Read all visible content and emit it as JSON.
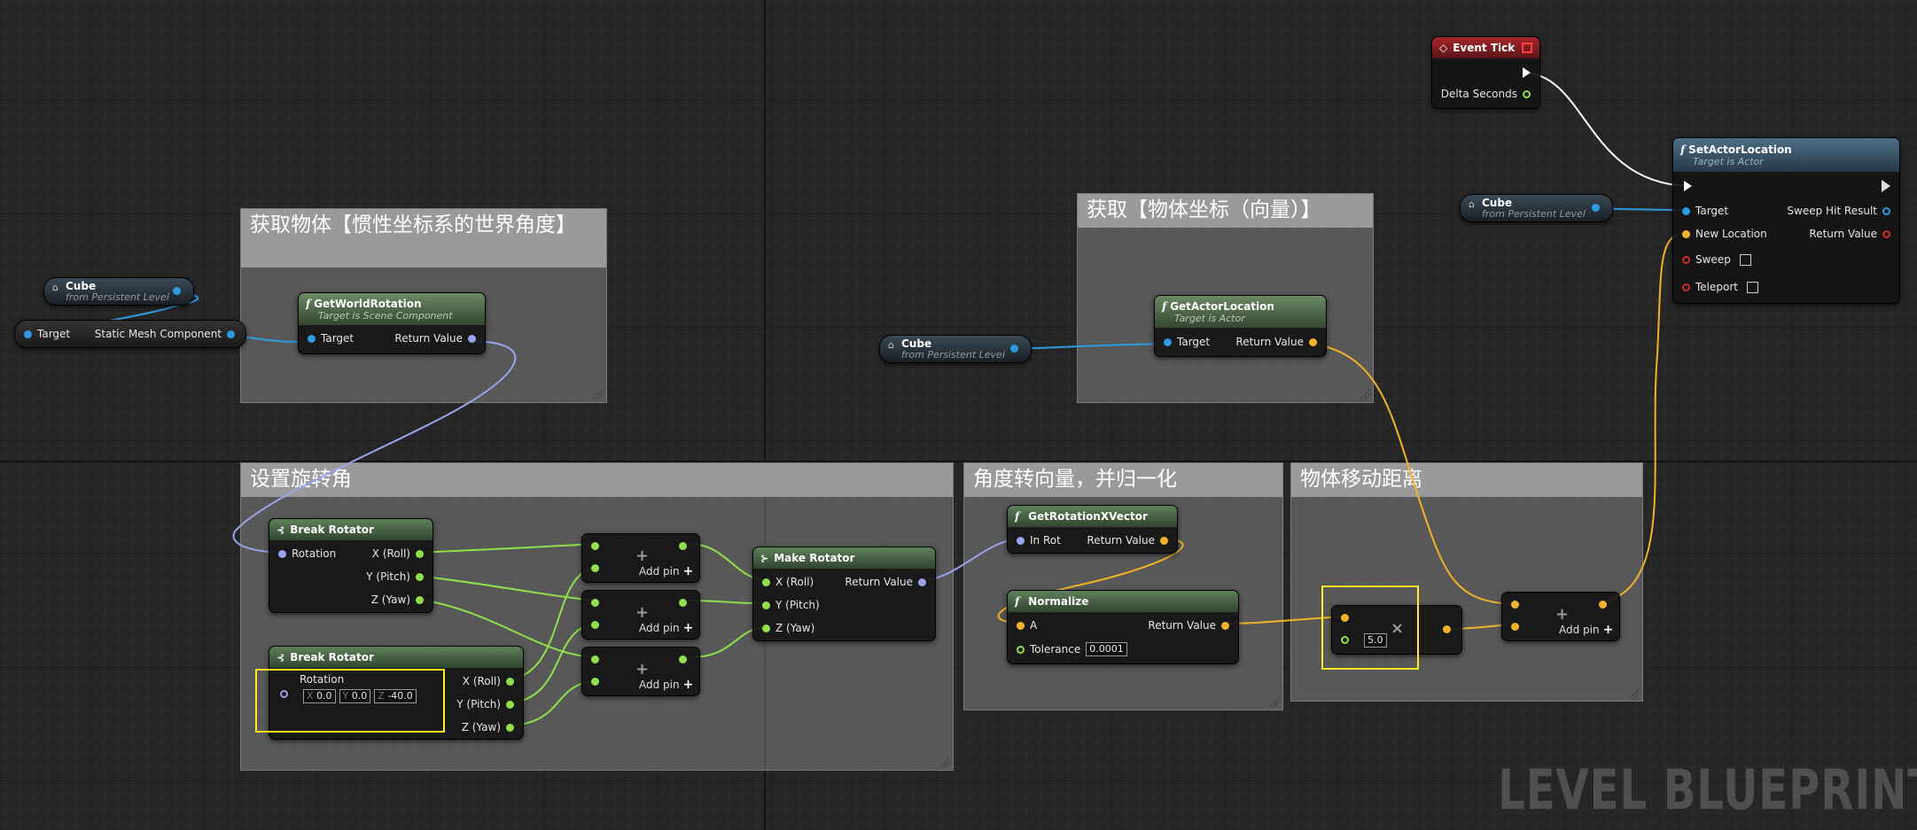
{
  "comments": {
    "get_rotation": "获取物体【惯性坐标系的世界角度】",
    "set_rotation": "设置旋转角",
    "get_location": "获取【物体坐标（向量）】",
    "angle_to_vector": "角度转向量，并归一化",
    "move_distance": "物体移动距离"
  },
  "cube_ref": {
    "name": "Cube",
    "sub": "from Persistent Level"
  },
  "target_node": {
    "target": "Target",
    "out": "Static Mesh Component"
  },
  "get_world_rotation": {
    "title": "GetWorldRotation",
    "sub": "Target is Scene Component",
    "in": "Target",
    "out": "Return Value"
  },
  "get_actor_location": {
    "title": "GetActorLocation",
    "sub": "Target is Actor",
    "in": "Target",
    "out": "Return Value"
  },
  "event_tick": {
    "title": "Event Tick",
    "out": "Delta Seconds"
  },
  "set_actor_location": {
    "title": "SetActorLocation",
    "sub": "Target is Actor",
    "target": "Target",
    "new_location": "New Location",
    "sweep": "Sweep",
    "teleport": "Teleport",
    "sweep_hit": "Sweep Hit Result",
    "ret": "Return Value"
  },
  "break_rotator_1": {
    "title": "Break Rotator",
    "in": "Rotation",
    "x": "X (Roll)",
    "y": "Y (Pitch)",
    "z": "Z (Yaw)"
  },
  "break_rotator_2": {
    "title": "Break Rotator",
    "in": "Rotation",
    "x": "X (Roll)",
    "y": "Y (Pitch)",
    "z": "Z (Yaw)",
    "lx": "X",
    "ly": "Y",
    "lz": "Z",
    "vx": "0.0",
    "vy": "0.0",
    "vz": "-40.0"
  },
  "add_pin": "Add pin",
  "make_rotator": {
    "title": "Make Rotator",
    "x": "X (Roll)",
    "y": "Y (Pitch)",
    "z": "Z (Yaw)",
    "out": "Return Value"
  },
  "get_rotation_x_vector": {
    "title": "GetRotationXVector",
    "in": "In Rot",
    "out": "Return Value"
  },
  "normalize": {
    "title": "Normalize",
    "a": "A",
    "tol": "Tolerance",
    "tol_val": "0.0001",
    "out": "Return Value"
  },
  "multiply": {
    "value": "5.0"
  },
  "watermark": "LEVEL BLUEPRINT",
  "colors": {
    "vector": "#f2b22a",
    "float": "#8fe04a",
    "rotator": "#9aa4ea",
    "object": "#2e9be0",
    "exec": "#ffffff",
    "highlight": "#ffee22"
  }
}
